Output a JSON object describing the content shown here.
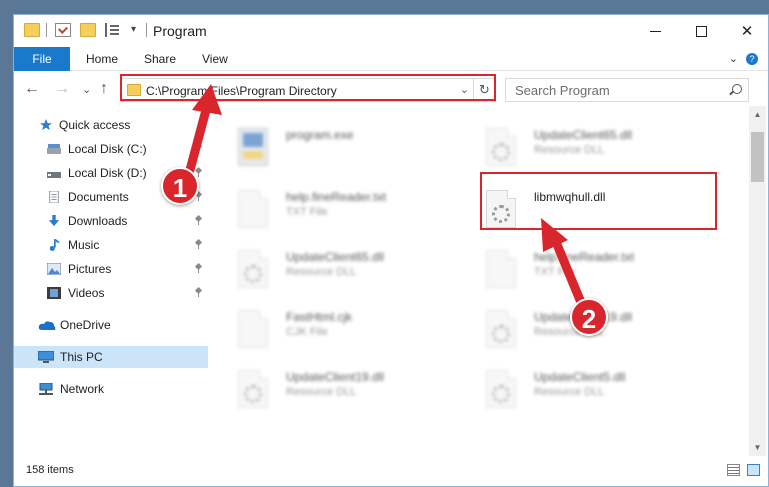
{
  "window": {
    "title": "Program",
    "minimize_glyph": "",
    "close_glyph": "✕"
  },
  "ribbon": {
    "tabs": [
      {
        "label": "File"
      },
      {
        "label": "Home"
      },
      {
        "label": "Share"
      },
      {
        "label": "View"
      }
    ],
    "collapse_glyph": "⌄",
    "help_glyph": "?"
  },
  "nav": {
    "back_glyph": "←",
    "forward_glyph": "→",
    "recent_glyph": "⌄",
    "up_glyph": "↑"
  },
  "address": {
    "path": "C:\\Program Files\\Program Directory",
    "dropdown_glyph": "⌄",
    "refresh_glyph": "↻"
  },
  "search": {
    "placeholder": "Search Program"
  },
  "sidebar": {
    "items": [
      {
        "label": "Quick access",
        "icon": "star-icon"
      },
      {
        "label": "Local Disk (C:)",
        "icon": "drive-icon"
      },
      {
        "label": "Local Disk (D:)",
        "icon": "drive-icon"
      },
      {
        "label": "Documents",
        "icon": "documents-icon"
      },
      {
        "label": "Downloads",
        "icon": "downloads-icon"
      },
      {
        "label": "Music",
        "icon": "music-icon"
      },
      {
        "label": "Pictures",
        "icon": "pictures-icon"
      },
      {
        "label": "Videos",
        "icon": "videos-icon"
      },
      {
        "label": "OneDrive",
        "icon": "cloud-icon"
      },
      {
        "label": "This PC",
        "icon": "computer-icon"
      },
      {
        "label": "Network",
        "icon": "network-icon"
      }
    ]
  },
  "files": [
    {
      "name": "program.exe",
      "type": ""
    },
    {
      "name": "UpdateClient65.dll",
      "type": "Resource DLL"
    },
    {
      "name": "help.fineReader.txt",
      "type": "TXT File"
    },
    {
      "name": "libmwqhull.dll",
      "type": ""
    },
    {
      "name": "UpdateClient65.dll",
      "type": "Resource DLL"
    },
    {
      "name": "help.fineReader.txt",
      "type": "TXT File"
    },
    {
      "name": "FastHtml.cjk",
      "type": "CJK File"
    },
    {
      "name": "UpdateClient19.dll",
      "type": "Resource DLL"
    },
    {
      "name": "UpdateClient19.dll",
      "type": "Resource DLL"
    },
    {
      "name": "UpdateClient5.dll",
      "type": "Resource DLL"
    }
  ],
  "scrollbar": {
    "up_glyph": "▲",
    "down_glyph": "▼"
  },
  "status": {
    "item_count": "158 items"
  },
  "callouts": [
    {
      "label": "1"
    },
    {
      "label": "2"
    }
  ],
  "colors": {
    "accent": "#1979ca",
    "highlight": "#d9252c",
    "selection": "#cce4f7"
  }
}
